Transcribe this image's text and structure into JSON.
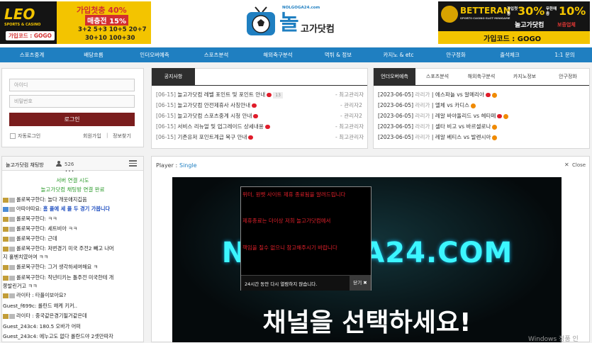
{
  "ads": {
    "left": {
      "brand": "LEO",
      "line1": "가입첫충 40%",
      "line2": "매충전 15%",
      "line3": "3+2 5+3 10+5 20+7",
      "line4": "30+10 100+30",
      "code": "가입코드 : GOGO",
      "sub": "SPORTS & CASINO"
    },
    "right": {
      "brand": "BETTERAN",
      "brand_sub": "SPORTS·CASINO·SLOT·MINIGAME",
      "line1a": "가입첫충",
      "pct1": "30%",
      "line2a": "무한매충",
      "pct2": "10%",
      "partner": "놀고가닷컴",
      "notice": "보증업체",
      "code": "가입코드 : GOGO"
    }
  },
  "logo": {
    "small": "NOLGOGA24.com",
    "big": "놀",
    "name": "고가닷컴"
  },
  "nav": [
    "스포츠중계",
    "배당흐름",
    "인더오버예측",
    "스포츠분석",
    "해외축구분석",
    "먹튀 & 정보",
    "카지노 & etc",
    "안구정화",
    "출석체크",
    "1:1 문의"
  ],
  "login": {
    "id_placeholder": "아이디",
    "pw_placeholder": "비밀번호",
    "button": "로그인",
    "auto": "자동로그인",
    "join": "회원가입",
    "divider": "|",
    "find": "정보찾기"
  },
  "notice": {
    "tab": "공지사항",
    "items": [
      {
        "date": "[06-15]",
        "title": "놀고가닷컴 레벨 포인트 및 포인트 안내",
        "count": "13",
        "author": "- 최고관리자"
      },
      {
        "date": "[06-15]",
        "title": "놀고가닷컴 안전제휴사 사칭안내",
        "author": "- 관리자2"
      },
      {
        "date": "[06-15]",
        "title": "놀고가닷컴 스포츠중계 시청 안내",
        "author": "- 관리자2"
      },
      {
        "date": "[06-15]",
        "title": "서비스 리뉴얼 및 업그레이드 상세내용",
        "author": "- 최고관리자"
      },
      {
        "date": "[06-15]",
        "title": "기존유저 포인트계급 복구 안내",
        "author": "- 최고관리자"
      }
    ]
  },
  "predict": {
    "tabs": [
      "언더오버예측",
      "스포츠분석",
      "해외축구분석",
      "카지노정보",
      "안구정화"
    ],
    "items": [
      {
        "date": "[2023-06-05]",
        "author": "라리가",
        "sep": "|",
        "title": "에스파뇰 vs 알메리아"
      },
      {
        "date": "[2023-06-05]",
        "author": "라리가",
        "sep": "|",
        "title": "엘체 vs 카디스"
      },
      {
        "date": "[2023-06-05]",
        "author": "라리가",
        "sep": "|",
        "title": "레알 바야돌리드 vs 헤타페"
      },
      {
        "date": "[2023-06-05]",
        "author": "라리가",
        "sep": "|",
        "title": "셀타 비고 vs 바르셀로나"
      },
      {
        "date": "[2023-06-05]",
        "author": "라리가",
        "sep": "|",
        "title": "레알 베티스 vs 발렌시아"
      }
    ]
  },
  "chat": {
    "title": "놀고가닷컴 채팅방",
    "users": "526",
    "dots": "• • •",
    "status1": "서버 연결 시도",
    "status2": "놀고가닷컴 채팅방 연결 완료",
    "lines": [
      {
        "user": "롤로복구한다:",
        "msg": "놀다 개웃애지깁음"
      },
      {
        "user": "아따아따요:",
        "msg": "홈 플에 세 플 두 경기 가봅니다",
        "blue": true
      },
      {
        "user": "롤로복구한다:",
        "msg": "ㅋㅋ"
      },
      {
        "user": "롤로복구한다:",
        "msg": "세트비아 ㅋㅋ"
      },
      {
        "user": "롤로복구한다:",
        "msg": "근데"
      },
      {
        "user": "롤로복구한다:",
        "msg": "저번경기 미국 주전2 빼고 나머"
      },
      {
        "user": "",
        "msg": "지 홀벤치였어여 ㅋㅋ"
      },
      {
        "user": "롤로복구한다:",
        "msg": "그거 생각하세여해요 ㅋ"
      },
      {
        "user": "롤로복구한다:",
        "msg": "작년티키는 톨주전 미국한테 개"
      },
      {
        "user": "",
        "msg": "쫑발린거고 ㅋㅋ"
      },
      {
        "user": "라이타 :",
        "msg": "타플이보아요?"
      },
      {
        "user": "Guest_f699c:",
        "msg": "롤란드 왜케 키커.."
      },
      {
        "user": "라이타 :",
        "msg": "중국같은경기될거같은데"
      },
      {
        "user": "Guest_243c4:",
        "msg": "180.5 오바가 어떠"
      },
      {
        "user": "Guest_243c4:",
        "msg": "에누고도 없다 롤란드야 2셋만따자"
      }
    ]
  },
  "player": {
    "label": "Player :",
    "mode": "Single",
    "close": "Close",
    "brand_text": "NOLGOGA24.COM",
    "select_text": "채널을 선택하세요!"
  },
  "popup": {
    "line1": "위터, 원벳 사이트 제휴 종료됨을 알려드립니다",
    "line2": "제휴종료는 더이상 저희 놀고가닷컴에서",
    "line3": "책임을 질수 없으니 참고해주시기 바랍니다",
    "footer": "24시간 동안 다시 열람하지 않습니다.",
    "close": "닫기 ✖"
  },
  "windows_watermark": "Windows 정품 인"
}
